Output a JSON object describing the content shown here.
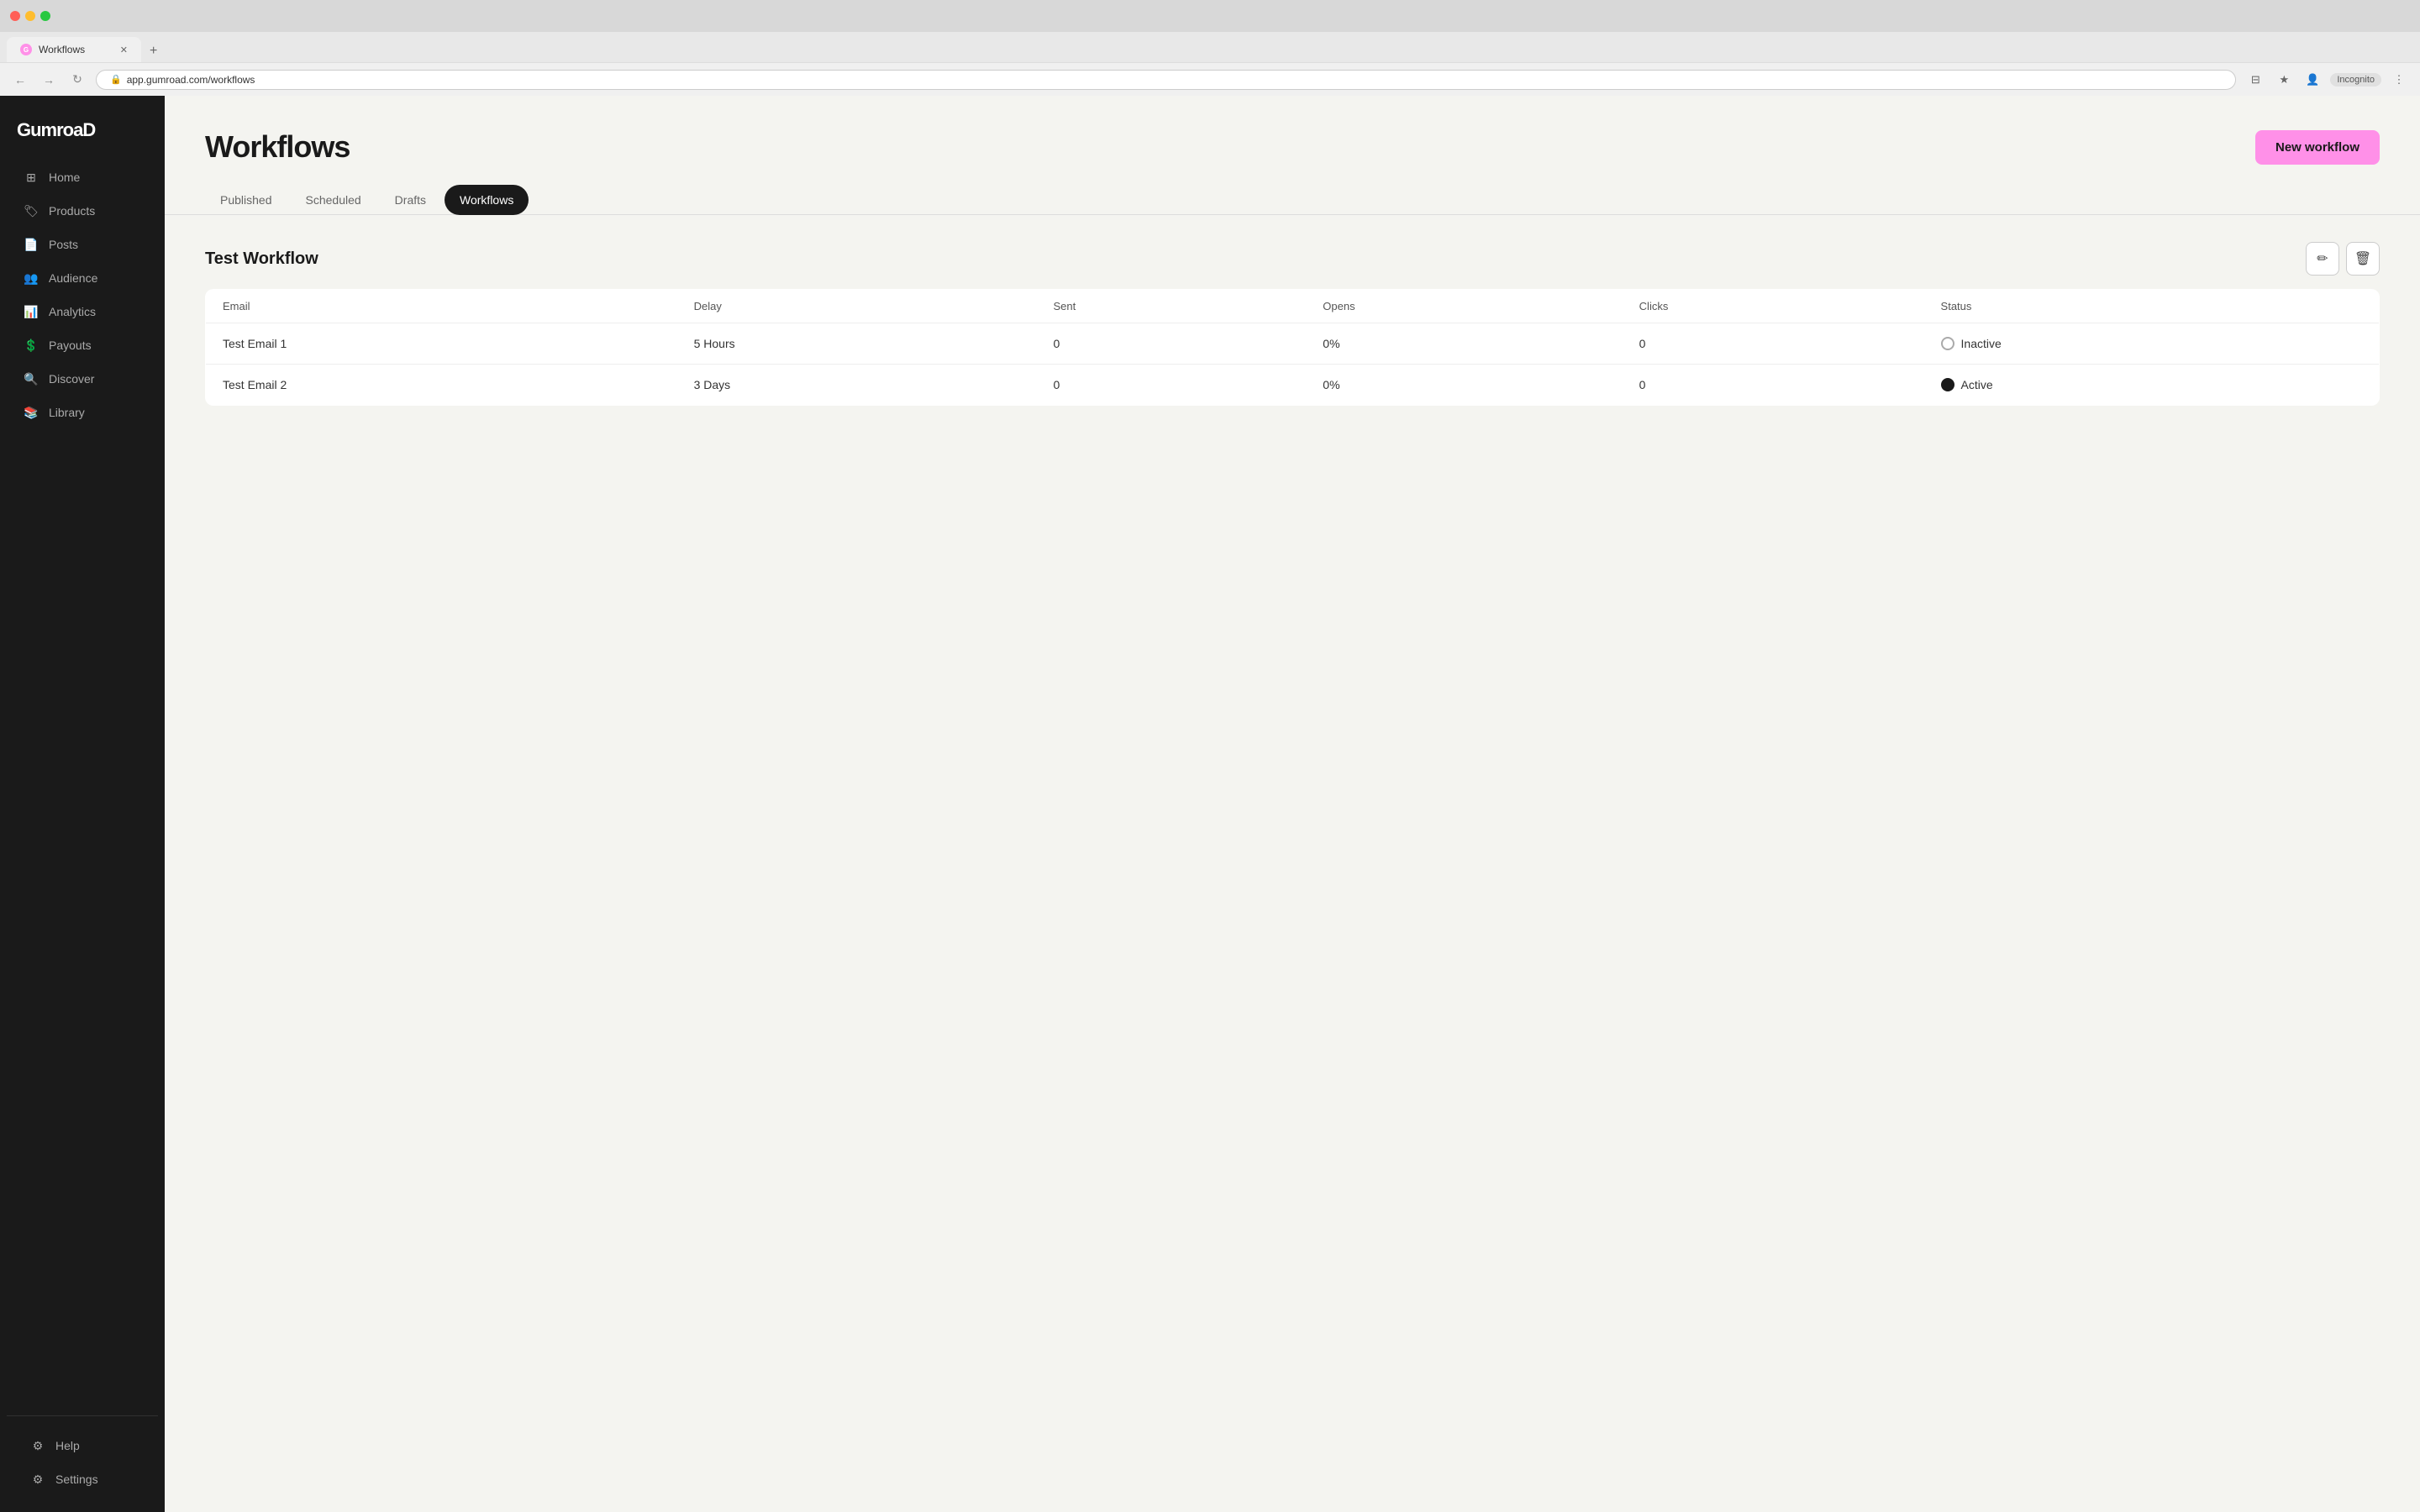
{
  "browser": {
    "tab_title": "Workflows",
    "url": "app.gumroad.com/workflows",
    "new_tab_label": "+",
    "incognito_label": "Incognito"
  },
  "logo": {
    "text": "GumroaD"
  },
  "sidebar": {
    "items": [
      {
        "id": "home",
        "label": "Home",
        "icon": "⊞"
      },
      {
        "id": "products",
        "label": "Products",
        "icon": "🏷"
      },
      {
        "id": "posts",
        "label": "Posts",
        "icon": "📄"
      },
      {
        "id": "audience",
        "label": "Audience",
        "icon": "👥"
      },
      {
        "id": "analytics",
        "label": "Analytics",
        "icon": "📊"
      },
      {
        "id": "payouts",
        "label": "Payouts",
        "icon": "💲"
      },
      {
        "id": "discover",
        "label": "Discover",
        "icon": "🔍"
      },
      {
        "id": "library",
        "label": "Library",
        "icon": "📚"
      }
    ],
    "bottom_items": [
      {
        "id": "help",
        "label": "Help",
        "icon": "⚙"
      },
      {
        "id": "settings",
        "label": "Settings",
        "icon": "⚙"
      }
    ]
  },
  "page": {
    "title": "Workflows",
    "new_workflow_button": "New workflow"
  },
  "tabs": [
    {
      "id": "published",
      "label": "Published",
      "active": false
    },
    {
      "id": "scheduled",
      "label": "Scheduled",
      "active": false
    },
    {
      "id": "drafts",
      "label": "Drafts",
      "active": false
    },
    {
      "id": "workflows",
      "label": "Workflows",
      "active": true
    }
  ],
  "workflow": {
    "name": "Test Workflow",
    "edit_button_label": "✏",
    "delete_button_label": "🗑",
    "table": {
      "columns": [
        "Email",
        "Delay",
        "Sent",
        "Opens",
        "Clicks",
        "Status"
      ],
      "rows": [
        {
          "email": "Test Email 1",
          "delay": "5 Hours",
          "sent": "0",
          "opens": "0%",
          "clicks": "0",
          "status": "Inactive",
          "status_type": "inactive"
        },
        {
          "email": "Test Email 2",
          "delay": "3 Days",
          "sent": "0",
          "opens": "0%",
          "clicks": "0",
          "status": "Active",
          "status_type": "active"
        }
      ]
    }
  }
}
